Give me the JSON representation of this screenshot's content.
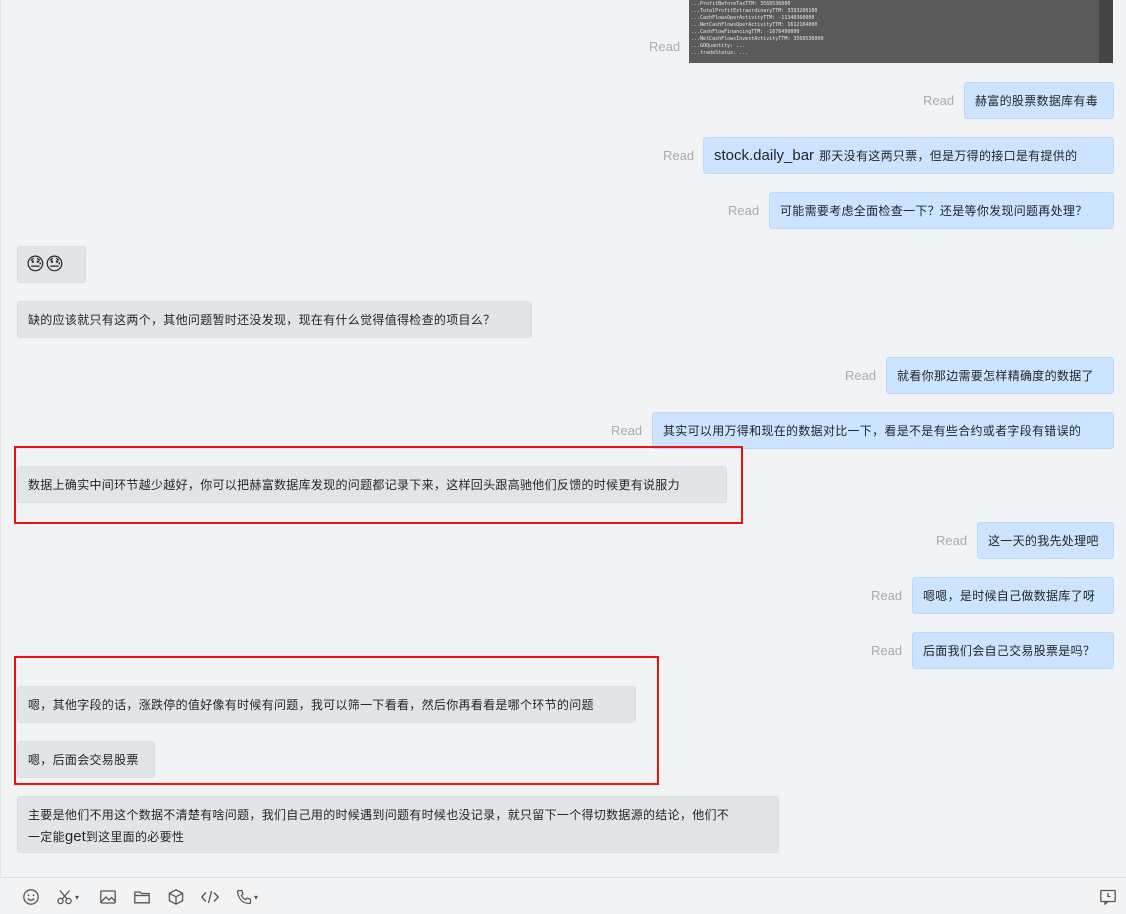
{
  "read_label": "Read",
  "screenshot_lines": [
    "...ProfitBeforeTaxTTM:  3560536000",
    "...TotalProfitExtraordinaryTTM:  3393200100",
    "...CashFlowsOperActivityTTM: -11340360000",
    "...NetCashFlowsOperActivityTTM:  1612104000",
    "...CashFlowFinancingTTM:  -1676490000",
    "...NetCashFlowsInvestActivityTTM:  3560536000",
    "...GOQuantity:  ...",
    "...tradeStatus: ..."
  ],
  "messages": {
    "m1": "赫富的股票数据库有毒",
    "m2_code": "stock.daily_bar",
    "m2_rest": "那天没有这两只票，但是万得的接口是有提供的",
    "m3": "可能需要考虑全面检查一下？还是等你发现问题再处理？",
    "m4_emoji": "😓😓",
    "m5": "缺的应该就只有这两个，其他问题暂时还没发现，现在有什么觉得值得检查的项目么？",
    "m6": "就看你那边需要怎样精确度的数据了",
    "m7": "其实可以用万得和现在的数据对比一下，看是不是有些合约或者字段有错误的",
    "m8": "数据上确实中间环节越少越好，你可以把赫富数据库发现的问题都记录下来，这样回头跟高驰他们反馈的时候更有说服力",
    "m9": "这一天的我先处理吧",
    "m10": "嗯嗯，是时候自己做数据库了呀",
    "m11": "后面我们会自己交易股票是吗？",
    "m12": "嗯，其他字段的话，涨跌停的值好像有时候有问题，我可以筛一下看看，然后你再看看是哪个环节的问题",
    "m13": "嗯，后面会交易股票",
    "m14_a": "主要是他们不用这个数据不清楚有啥问题，我们自己用的时候遇到问题有时候也没记录，就只留下一个得切数据源的结论，他们不",
    "m14_b_pre": "一定能",
    "m14_b_get": "get",
    "m14_b_post": "到这里面的必要性"
  },
  "toolbar": {
    "icons": [
      "emoji-icon",
      "scissors-icon",
      "image-icon",
      "folder-icon",
      "box-icon",
      "code-icon",
      "phone-icon",
      "history-icon"
    ]
  },
  "colors": {
    "outgoing_bubble": "#cce4ff",
    "incoming_bubble": "#e3e4e7",
    "highlight": "#ee1111",
    "read_text": "#a8abb2"
  }
}
